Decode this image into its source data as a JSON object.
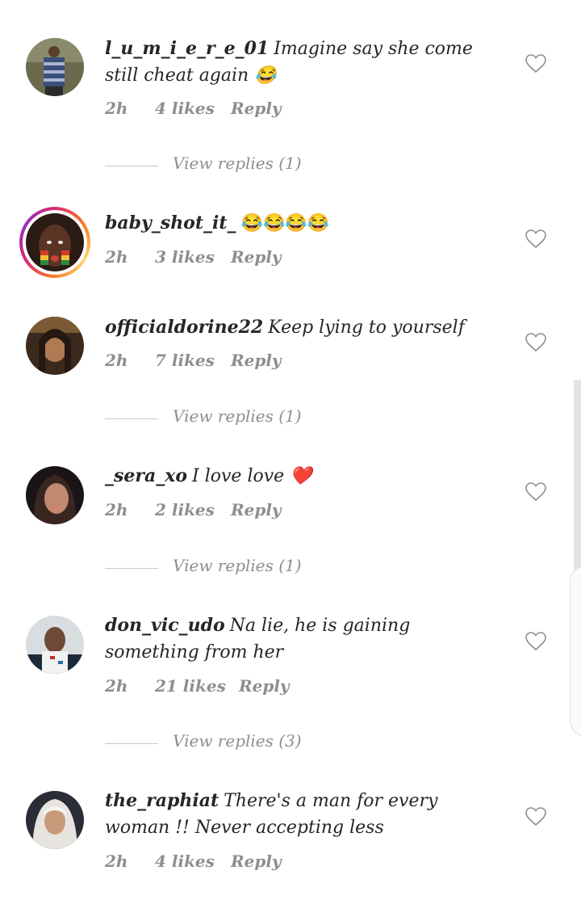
{
  "comments": [
    {
      "username": "l_u_m_i_e_r_e_01",
      "text": "Imagine say she come still cheat again 😂",
      "time": "2h",
      "likes": "4 likes",
      "reply": "Reply",
      "view_replies": "View replies (1)"
    },
    {
      "username": "baby_shot_it_",
      "text": "😂😂😂😂",
      "time": "2h",
      "likes": "3 likes",
      "reply": "Reply",
      "has_story": true
    },
    {
      "username": "officialdorine22",
      "text": "Keep lying to yourself",
      "time": "2h",
      "likes": "7 likes",
      "reply": "Reply",
      "view_replies": "View replies (1)"
    },
    {
      "username": "_sera_xo",
      "text": "I love love ❤️",
      "time": "2h",
      "likes": "2 likes",
      "reply": "Reply",
      "view_replies": "View replies (1)"
    },
    {
      "username": "don_vic_udo",
      "text": "Na lie, he is gaining something from her",
      "time": "2h",
      "likes": "21 likes",
      "reply": "Reply",
      "view_replies": "View replies (3)"
    },
    {
      "username": "the_raphiat",
      "text": "There's a man for every woman !! Never accepting less",
      "time": "2h",
      "likes": "4 likes",
      "reply": "Reply"
    }
  ],
  "icons": {
    "like": "heart-outline-icon"
  },
  "colors": {
    "text": "#262626",
    "meta": "#8e8e8e",
    "story_ring": "#d62976"
  }
}
